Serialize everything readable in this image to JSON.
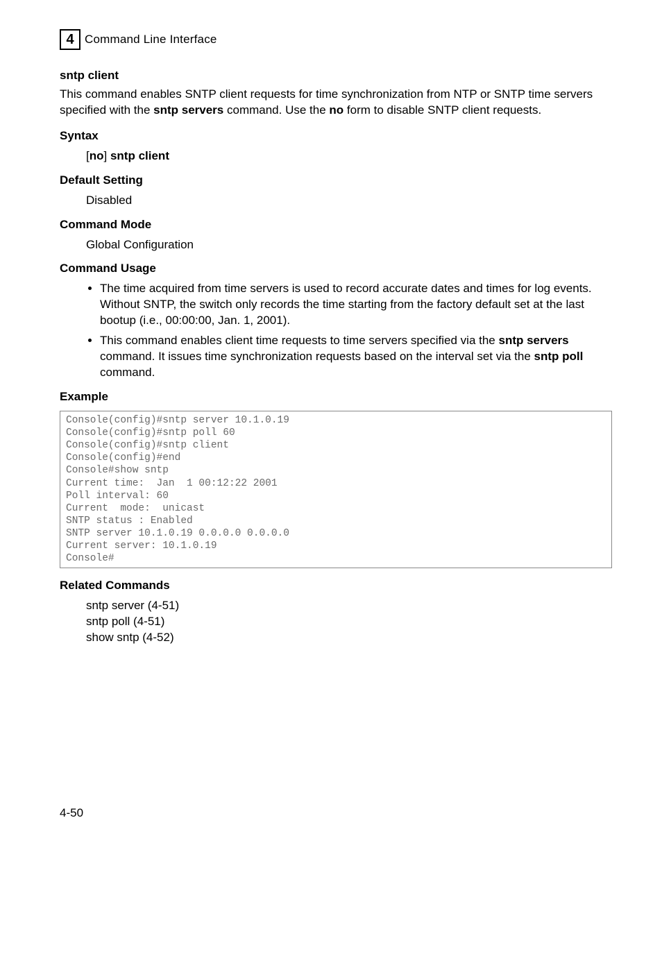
{
  "header": {
    "chapter_number": "4",
    "chapter_title": "Command Line Interface"
  },
  "section": {
    "title": "sntp client",
    "intro_p1": "This command enables SNTP client requests for time synchronization from NTP or SNTP time servers specified with the ",
    "intro_bold1": "sntp servers",
    "intro_p2": " command. Use the ",
    "intro_bold2": "no",
    "intro_p3": " form to disable SNTP client requests."
  },
  "syntax": {
    "title": "Syntax",
    "open_bracket": "[",
    "no": "no",
    "close_bracket": "] ",
    "cmd": "sntp client"
  },
  "default_setting": {
    "title": "Default Setting",
    "value": "Disabled"
  },
  "command_mode": {
    "title": "Command Mode",
    "value": "Global Configuration"
  },
  "command_usage": {
    "title": "Command Usage",
    "bullet1": "The time acquired from time servers is used to record accurate dates and times for log events. Without SNTP, the switch only records the time starting from the factory default set at the last bootup (i.e., 00:00:00, Jan. 1, 2001).",
    "bullet2_p1": "This command enables client time requests to time servers specified via the ",
    "bullet2_b1": "sntp servers",
    "bullet2_p2": " command. It issues time synchronization requests based on the interval set via the ",
    "bullet2_b2": "sntp poll",
    "bullet2_p3": " command."
  },
  "example": {
    "title": "Example",
    "code": "Console(config)#sntp server 10.1.0.19\nConsole(config)#sntp poll 60\nConsole(config)#sntp client\nConsole(config)#end\nConsole#show sntp\nCurrent time:  Jan  1 00:12:22 2001\nPoll interval: 60\nCurrent  mode:  unicast\nSNTP status : Enabled\nSNTP server 10.1.0.19 0.0.0.0 0.0.0.0\nCurrent server: 10.1.0.19\nConsole#"
  },
  "related": {
    "title": "Related Commands",
    "items": [
      "sntp server (4-51)",
      "sntp poll (4-51)",
      "show sntp (4-52)"
    ]
  },
  "page_number": "4-50"
}
